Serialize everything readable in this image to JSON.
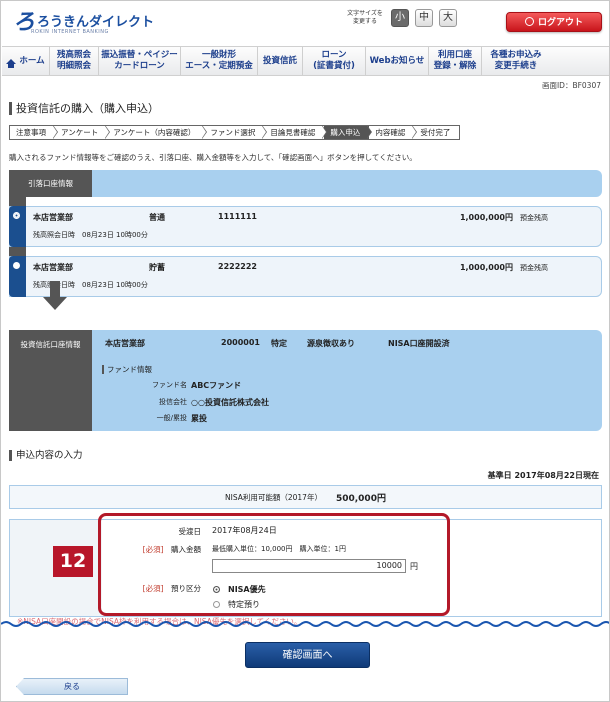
{
  "header": {
    "logo_mark": "ろ",
    "logo_text": "ろうきんダイレクト",
    "logo_sub": "ROKIN INTERNET BANKING",
    "font_size_label": "文字サイズを\n変更する",
    "font_sizes": [
      "小",
      "中",
      "大"
    ],
    "active_font_size": "小",
    "logout_label": "ログアウト"
  },
  "nav": {
    "items": [
      {
        "label": "ホーム"
      },
      {
        "label": "残高照会\n明細照会"
      },
      {
        "label": "振込振替・ペイジー\nカードローン"
      },
      {
        "label": "一般財形\nエース・定期預金"
      },
      {
        "label": "投資信託"
      },
      {
        "label": "ローン\n(証書貸付)"
      },
      {
        "label": "Webお知らせ"
      },
      {
        "label": "利用口座\n登録・解除"
      },
      {
        "label": "各種お申込み\n変更手続き"
      }
    ]
  },
  "screen_id": "画面ID：BF0307",
  "page_title": "投資信託の購入（購入申込）",
  "steps": [
    "注意事項",
    "アンケート",
    "アンケート（内容確認）",
    "ファンド選択",
    "目論見書確認",
    "購入申込",
    "内容確認",
    "受付完了"
  ],
  "active_step": "購入申込",
  "description": "購入されるファンド情報等をご確認のうえ、引落口座、購入金額等を入力して、「確認画面へ」ボタンを押してください。",
  "withdrawal": {
    "label": "引落口座情報",
    "accounts": [
      {
        "branch": "本店営業部",
        "type": "普通",
        "number": "1111111",
        "balance": "1,000,000円",
        "balance_label": "預金残高",
        "inquiry": "残高照会日時　08月23日 10時00分",
        "selected": true
      },
      {
        "branch": "本店営業部",
        "type": "貯蓄",
        "number": "2222222",
        "balance": "1,000,000円",
        "balance_label": "預金残高",
        "inquiry": "残高照会日時　08月23日 10時00分",
        "selected": false
      }
    ]
  },
  "fund_account": {
    "label": "投資信託口座情報",
    "branch": "本店営業部",
    "number": "2000001",
    "specific": "特定",
    "withholding": "源泉徴収あり",
    "nisa": "NISA口座開設済",
    "fund_info_title": "ファンド情報",
    "rows": [
      {
        "label": "ファンド名",
        "value": "ABCファンド"
      },
      {
        "label": "投信会社",
        "value": "○○投資信託株式会社"
      },
      {
        "label": "一般/累投",
        "value": "累投"
      }
    ]
  },
  "entry": {
    "section_title": "申込内容の入力",
    "base_date": "基準日 2017年08月22日現在",
    "nisa_label": "NISA利用可能額（2017年）",
    "nisa_value": "500,000円",
    "badge": "12",
    "accept_label": "受渡日",
    "accept_value": "2017年08月24日",
    "required": "[必須]",
    "amount_label": "購入金額",
    "amount_note": "最低購入単位：10,000円　購入単位：1円",
    "amount_value": "10000",
    "amount_unit": "円",
    "deposit_label": "預り区分",
    "options": [
      {
        "label": "NISA優先",
        "selected": true
      },
      {
        "label": "特定預り",
        "selected": false
      }
    ],
    "warning": "※NISA口座開設の場合でNISA枠を利用する場合は、NISA優先を選択してください。"
  },
  "buttons": {
    "confirm": "確認画面へ",
    "back": "戻る"
  }
}
